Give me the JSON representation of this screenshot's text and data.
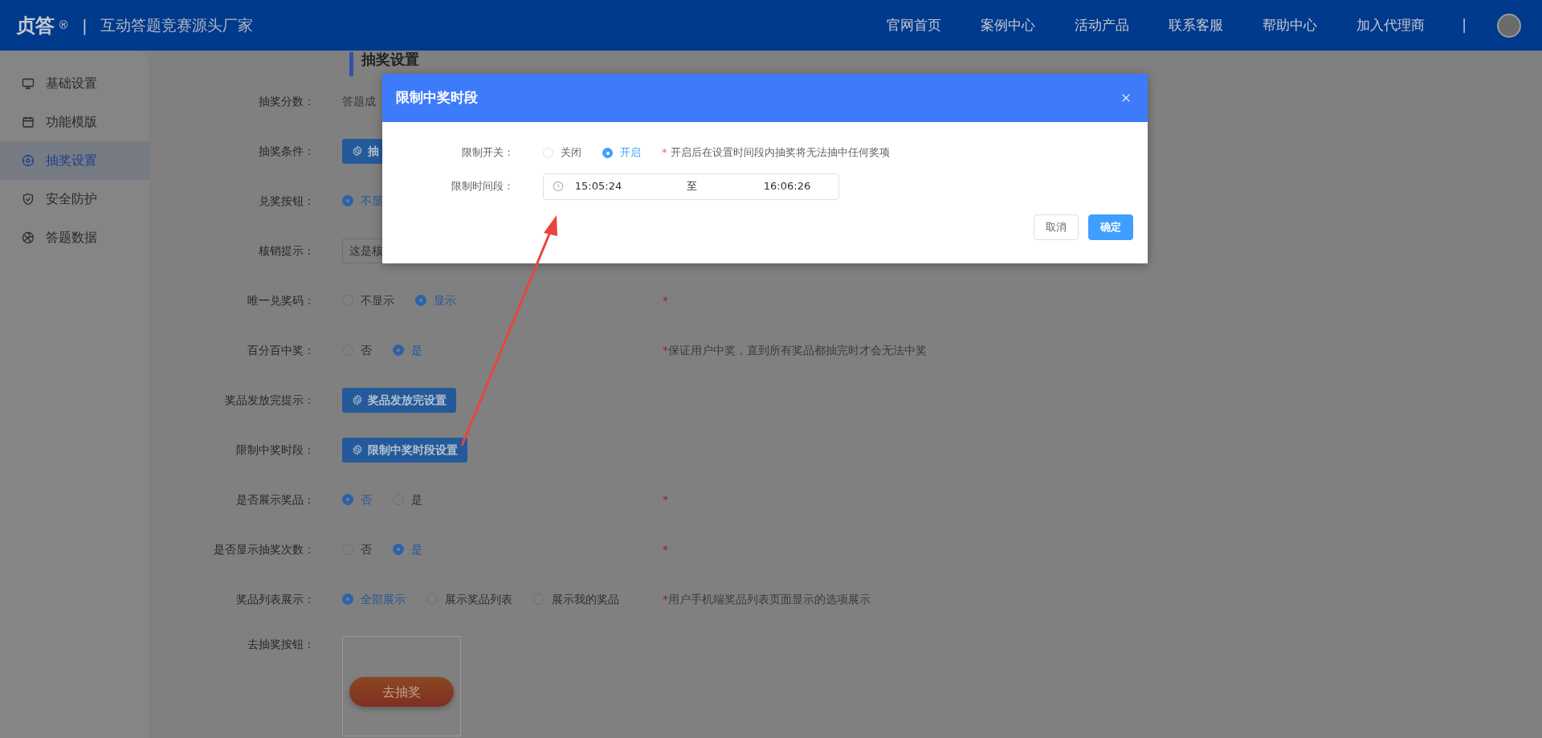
{
  "header": {
    "logo": "贞答",
    "registered_mark": "®",
    "divider": "|",
    "tagline": "互动答题竞赛源头厂家",
    "nav": [
      "官网首页",
      "案例中心",
      "活动产品",
      "联系客服",
      "帮助中心",
      "加入代理商"
    ],
    "nav_divider": "|"
  },
  "sidebar": {
    "items": [
      {
        "label": "基础设置",
        "selected": false
      },
      {
        "label": "功能模版",
        "selected": false
      },
      {
        "label": "抽奖设置",
        "selected": true
      },
      {
        "label": "安全防护",
        "selected": false
      },
      {
        "label": "答题数据",
        "selected": false
      }
    ]
  },
  "section_title": "抽奖设置",
  "form": {
    "rows": [
      {
        "label": "抽奖分数：",
        "kind": "text",
        "value": "答题成"
      },
      {
        "label": "抽奖条件：",
        "kind": "button",
        "button": "抽"
      },
      {
        "label": "兑奖按钮：",
        "kind": "radio",
        "options": [
          {
            "label": "不显",
            "selected": true
          }
        ]
      },
      {
        "label": "核销提示：",
        "kind": "input",
        "value": "这是核"
      },
      {
        "label": "唯一兑奖码：",
        "kind": "radio",
        "options": [
          {
            "label": "不显示",
            "selected": false
          },
          {
            "label": "显示",
            "selected": true
          }
        ],
        "required_mark": "*"
      },
      {
        "label": "百分百中奖：",
        "kind": "radio",
        "options": [
          {
            "label": "否",
            "selected": false
          },
          {
            "label": "是",
            "selected": true
          }
        ],
        "required_mark": "*",
        "hint": "保证用户中奖，直到所有奖品都抽完时才会无法中奖"
      },
      {
        "label": "奖品发放完提示：",
        "kind": "button",
        "button": "奖品发放完设置"
      },
      {
        "label": "限制中奖时段：",
        "kind": "button",
        "button": "限制中奖时段设置"
      },
      {
        "label": "是否展示奖品：",
        "kind": "radio",
        "options": [
          {
            "label": "否",
            "selected": true
          },
          {
            "label": "是",
            "selected": false
          }
        ],
        "required_mark": "*"
      },
      {
        "label": "是否显示抽奖次数：",
        "kind": "radio",
        "options": [
          {
            "label": "否",
            "selected": false
          },
          {
            "label": "是",
            "selected": true
          }
        ],
        "required_mark": "*"
      },
      {
        "label": "奖品列表展示：",
        "kind": "radio",
        "options": [
          {
            "label": "全部展示",
            "selected": true
          },
          {
            "label": "展示奖品列表",
            "selected": false
          },
          {
            "label": "展示我的奖品",
            "selected": false
          }
        ],
        "required_mark": "*",
        "hint": "用户手机端奖品列表页面显示的选项展示"
      },
      {
        "label": "去抽奖按钮：",
        "kind": "preview",
        "button": "去抽奖"
      }
    ]
  },
  "dialog": {
    "title": "限制中奖时段",
    "rows": [
      {
        "label": "限制开关：",
        "kind": "radio",
        "options": [
          {
            "label": "关闭",
            "selected": false
          },
          {
            "label": "开启",
            "selected": true
          }
        ],
        "required_mark": "*",
        "hint": "开启后在设置时间段内抽奖将无法抽中任何奖项"
      },
      {
        "label": "限制时间段：",
        "kind": "time_range",
        "start": "15:05:24",
        "separator": "至",
        "end": "16:06:26"
      }
    ],
    "buttons": [
      {
        "label": "取消",
        "kind": "default"
      },
      {
        "label": "确定",
        "kind": "primary"
      }
    ]
  }
}
